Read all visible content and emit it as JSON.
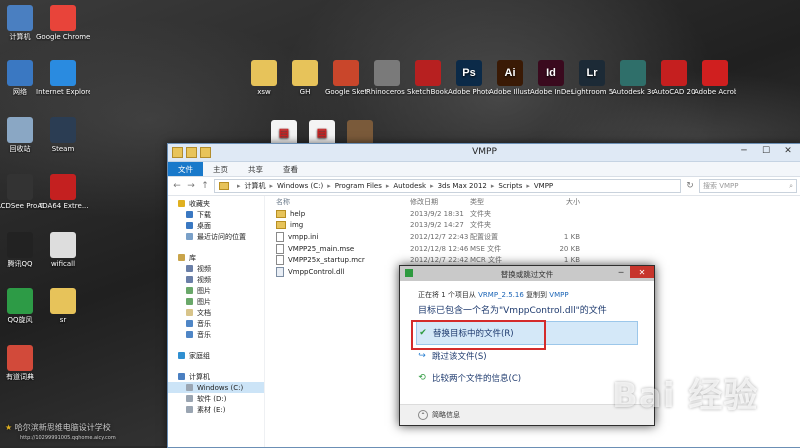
{
  "desktop_icons_left": [
    {
      "label": "计算机",
      "icon": "computer-icon",
      "color": "#4a7fc1"
    },
    {
      "label": "Google Chrome",
      "icon": "chrome-icon",
      "color": "#e8443a"
    },
    {
      "label": "网络",
      "icon": "network-icon",
      "color": "#3a78c2"
    },
    {
      "label": "Internet Explorer",
      "icon": "ie-icon",
      "color": "#2a8be0"
    },
    {
      "label": "回收站",
      "icon": "recycle-bin-icon",
      "color": "#8aa7c4"
    },
    {
      "label": "Steam",
      "icon": "steam-icon",
      "color": "#2b3d53"
    },
    {
      "label": "ACDSee Pro 6",
      "icon": "acdsee-icon",
      "color": "#333333"
    },
    {
      "label": "ADA64 Extre...",
      "icon": "aida64-icon",
      "color": "#c42020"
    },
    {
      "label": "腾讯QQ",
      "icon": "qq-icon",
      "color": "#222222"
    },
    {
      "label": "wificall",
      "icon": "wifi-icon",
      "color": "#dddddd"
    },
    {
      "label": "QQ旋风",
      "icon": "qq-whirlwind-icon",
      "color": "#2d9b46"
    },
    {
      "label": "sr",
      "icon": "folder-icon",
      "color": "#e7c35a"
    },
    {
      "label": "有道词典",
      "icon": "youdao-icon",
      "color": "#d24a3a"
    }
  ],
  "desktop_icons_top": [
    {
      "label": "xsw",
      "icon": "folder-icon",
      "color": "#e7c35a",
      "glyph": ""
    },
    {
      "label": "GH",
      "icon": "folder-icon",
      "color": "#e7c35a",
      "glyph": ""
    },
    {
      "label": "Google SketchUp 8",
      "icon": "sketchup-icon",
      "color": "#c9462b",
      "glyph": ""
    },
    {
      "label": "Rhinoceros 5 (64-bit)",
      "icon": "rhino-icon",
      "color": "#7a7a7a",
      "glyph": ""
    },
    {
      "label": "SketchBook Pro 2011",
      "icon": "sketchbook-icon",
      "color": "#b72020",
      "glyph": ""
    },
    {
      "label": "Adobe Photosh...",
      "icon": "photoshop-icon",
      "color": "#0b2a48",
      "glyph": "Ps"
    },
    {
      "label": "Adobe Illustrato...",
      "icon": "illustrator-icon",
      "color": "#3a1a05",
      "glyph": "Ai"
    },
    {
      "label": "Adobe InDesign ...",
      "icon": "indesign-icon",
      "color": "#3a0a1e",
      "glyph": "Id"
    },
    {
      "label": "Lightroom 5 64 位",
      "icon": "lightroom-icon",
      "color": "#1c2a36",
      "glyph": "Lr"
    },
    {
      "label": "Autodesk 3ds Max ...",
      "icon": "3dsmax-icon",
      "color": "#2f6f6a",
      "glyph": ""
    },
    {
      "label": "AutoCAD 2014 - ...",
      "icon": "autocad-icon",
      "color": "#c51f1f",
      "glyph": ""
    },
    {
      "label": "Adobe Acrobat...",
      "icon": "acrobat-icon",
      "color": "#d01f1f",
      "glyph": ""
    }
  ],
  "explorer": {
    "title": "VMPP",
    "ribbon_tabs": [
      "文件",
      "主页",
      "共享",
      "查看"
    ],
    "path": [
      "计算机",
      "Windows (C:)",
      "Program Files",
      "Autodesk",
      "3ds Max 2012",
      "Scripts",
      "VMPP"
    ],
    "search_placeholder": "搜索 VMPP",
    "nav": [
      {
        "label": "收藏夹",
        "icon": "star-icon",
        "head": true
      },
      {
        "label": "下载",
        "icon": "download-icon"
      },
      {
        "label": "桌面",
        "icon": "desktop-icon"
      },
      {
        "label": "最近访问的位置",
        "icon": "recent-icon"
      },
      {
        "gap": true
      },
      {
        "label": "库",
        "icon": "library-icon",
        "head": true
      },
      {
        "label": "视频",
        "icon": "video-icon"
      },
      {
        "label": "视频",
        "icon": "video-icon"
      },
      {
        "label": "图片",
        "icon": "picture-icon"
      },
      {
        "label": "图片",
        "icon": "picture-icon"
      },
      {
        "label": "文档",
        "icon": "document-icon"
      },
      {
        "label": "音乐",
        "icon": "music-icon"
      },
      {
        "label": "音乐",
        "icon": "music-icon"
      },
      {
        "gap": true
      },
      {
        "label": "家庭组",
        "icon": "homegroup-icon",
        "head": true
      },
      {
        "gap": true
      },
      {
        "label": "计算机",
        "icon": "computer-icon",
        "head": true
      },
      {
        "label": "Windows (C:)",
        "icon": "drive-icon",
        "selected": true
      },
      {
        "label": "软件 (D:)",
        "icon": "drive-icon"
      },
      {
        "label": "素材 (E:)",
        "icon": "drive-icon"
      }
    ],
    "columns": [
      "名称",
      "修改日期",
      "类型",
      "大小"
    ],
    "files": [
      {
        "name": "help",
        "kind": "folder",
        "date": "2013/9/2 18:31",
        "type": "文件夹",
        "size": ""
      },
      {
        "name": "img",
        "kind": "folder",
        "date": "2013/9/2 14:27",
        "type": "文件夹",
        "size": ""
      },
      {
        "name": "vmpp.ini",
        "kind": "file",
        "date": "2012/12/7 22:43",
        "type": "配置设置",
        "size": "1 KB"
      },
      {
        "name": "VMPP25_main.mse",
        "kind": "file",
        "date": "2012/12/8 12:46",
        "type": "MSE 文件",
        "size": "20 KB"
      },
      {
        "name": "VMPP25x_startup.mcr",
        "kind": "file",
        "date": "2012/12/7 22:42",
        "type": "MCR 文件",
        "size": "1 KB"
      },
      {
        "name": "VmppControl.dll",
        "kind": "dll",
        "date": "",
        "type": "",
        "size": ""
      }
    ]
  },
  "dialog": {
    "title": "替换或跳过文件",
    "info_prefix": "正在将 1 个项目从",
    "info_src": "VRMP_2.5.16",
    "info_mid": "复制到",
    "info_dst": "VMPP",
    "message": "目标已包含一个名为\"VmppControl.dll\"的文件",
    "options": [
      {
        "label": "替换目标中的文件(R)",
        "icon": "checkmark-icon",
        "glyph": "✔",
        "color": "#2e9a3f"
      },
      {
        "label": "跳过该文件(S)",
        "icon": "skip-icon",
        "glyph": "↪",
        "color": "#2a7fd1"
      },
      {
        "label": "比较两个文件的信息(C)",
        "icon": "compare-icon",
        "glyph": "⟲",
        "color": "#2e9a3f"
      }
    ],
    "footer": "简略信息"
  },
  "watermark": {
    "left_line1": "哈尔滨新思维电脑设计学校",
    "left_line2": "http://10299991005.qqhome.aicy.com",
    "right": "Bai 经验"
  },
  "colors": {
    "accent": "#1979ca",
    "selection": "#d4e8f8",
    "highlight_box": "#d42b2b"
  }
}
